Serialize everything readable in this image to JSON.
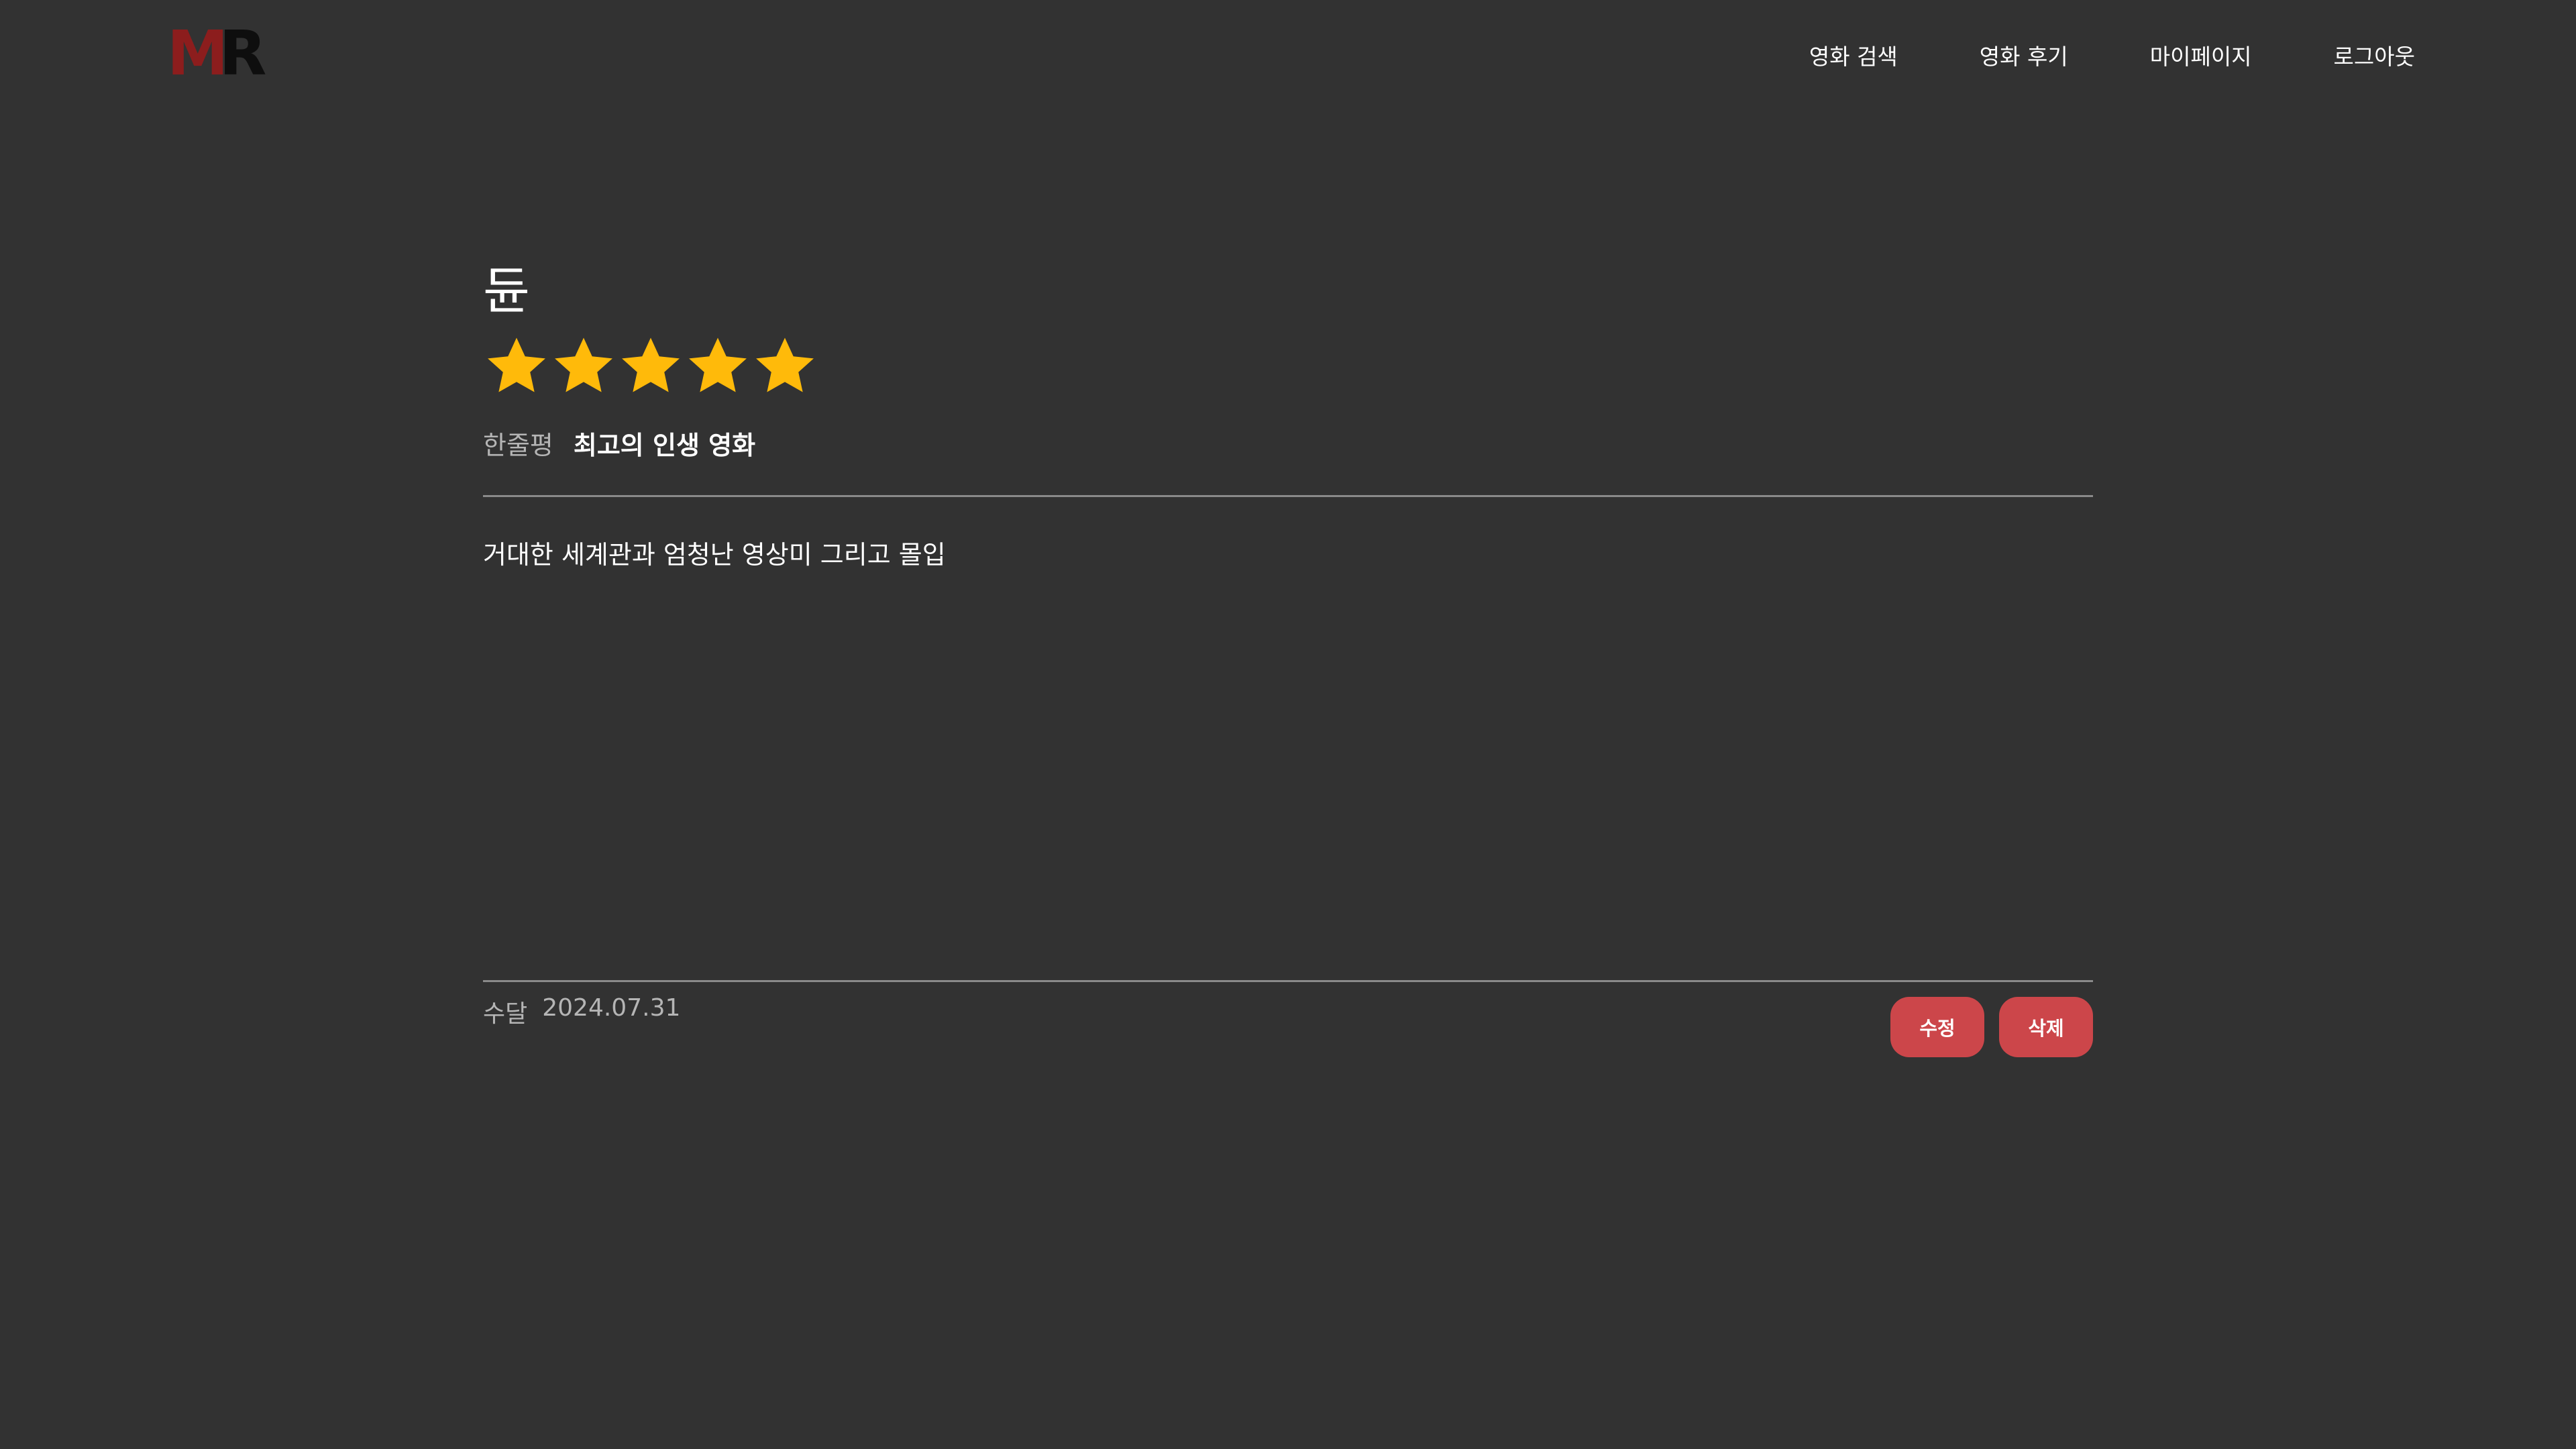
{
  "logo": {
    "first_letter": "M",
    "second_letter": "R",
    "first_color": "#8c1d1d",
    "second_color": "#0e0e0e"
  },
  "nav": {
    "items": [
      {
        "label": "영화 검색"
      },
      {
        "label": "영화 후기"
      },
      {
        "label": "마이페이지"
      },
      {
        "label": "로그아웃"
      }
    ]
  },
  "review": {
    "movie_title": "듄",
    "rating": 5,
    "rating_max": 5,
    "star_color": "#ffba0a",
    "oneliner_label": "한줄평",
    "oneliner": "최고의 인생 영화",
    "body": "거대한 세계관과 엄청난 영상미 그리고 몰입",
    "author": "수달",
    "date": "2024.07.31"
  },
  "actions": {
    "edit_label": "수정",
    "delete_label": "삭제",
    "button_color": "#cc464a"
  }
}
